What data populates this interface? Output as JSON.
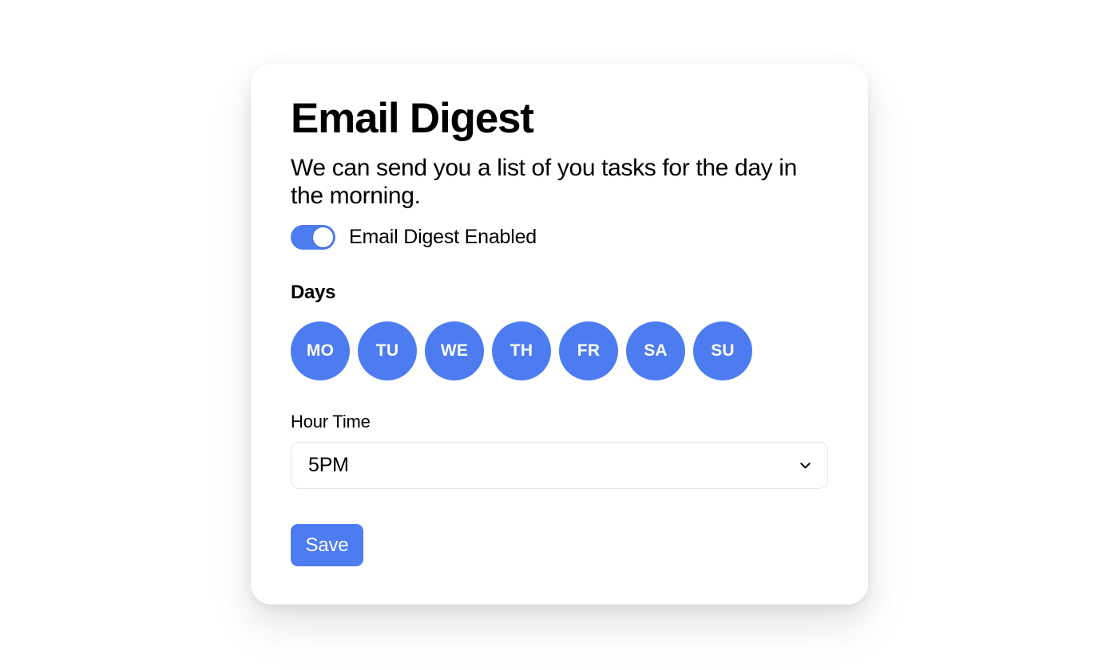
{
  "card": {
    "title": "Email Digest",
    "description": "We can send you a list of you tasks for the day in the morning.",
    "toggle": {
      "label": "Email Digest Enabled",
      "state": "on"
    },
    "days_section": {
      "heading": "Days",
      "days": [
        {
          "label": "MO",
          "selected": true
        },
        {
          "label": "TU",
          "selected": true
        },
        {
          "label": "WE",
          "selected": true
        },
        {
          "label": "TH",
          "selected": true
        },
        {
          "label": "FR",
          "selected": true
        },
        {
          "label": "SA",
          "selected": true
        },
        {
          "label": "SU",
          "selected": true
        }
      ]
    },
    "hour_time": {
      "label": "Hour Time",
      "value": "5PM",
      "icon": "chevron-down-icon"
    },
    "save_label": "Save"
  },
  "colors": {
    "accent": "#4d7cf0",
    "card_background": "#ffffff",
    "page_background": "#ffffff",
    "border": "#e6e7eb",
    "text": "#000000"
  }
}
